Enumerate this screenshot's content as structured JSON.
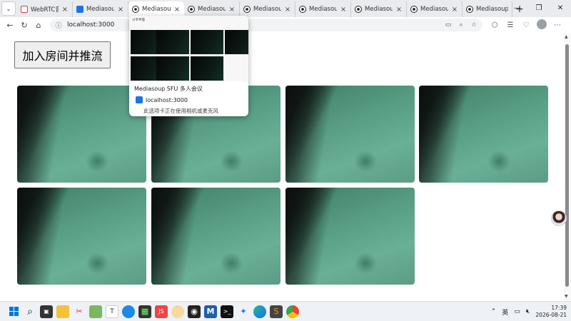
{
  "tabs": [
    {
      "label": "WebRTC音视频",
      "favicon": "doc",
      "active": false
    },
    {
      "label": "Mediasoup",
      "favicon": "blue",
      "active": false
    },
    {
      "label": "Mediasoup",
      "favicon": "rec",
      "active": true
    },
    {
      "label": "Mediasoup",
      "favicon": "rec",
      "active": false
    },
    {
      "label": "Mediasoup",
      "favicon": "rec",
      "active": false
    },
    {
      "label": "Mediasoup",
      "favicon": "rec",
      "active": false
    },
    {
      "label": "Mediasoup",
      "favicon": "rec",
      "active": false
    },
    {
      "label": "Mediasoup",
      "favicon": "rec",
      "active": false
    },
    {
      "label": "Mediasoup",
      "favicon": "rec",
      "active": false
    }
  ],
  "address_bar": {
    "url": "localhost:3000"
  },
  "page": {
    "join_button_label": "加入房间并推流"
  },
  "hover_card": {
    "thumb_label": "分享界面",
    "title": "Mediasoup SFU 多人会议",
    "site": "localhost:3000",
    "note": "此选项卡正在使用相机或麦克风"
  },
  "taskbar": {
    "ime": "英",
    "time": "17:39",
    "date": "2026-08-21"
  }
}
